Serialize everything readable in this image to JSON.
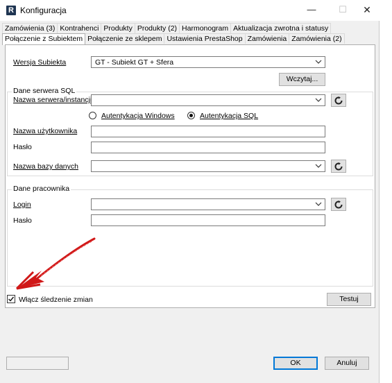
{
  "window": {
    "icon_letter": "R",
    "title": "Konfiguracja",
    "minimize": "—",
    "maximize": "☐",
    "close": "✕"
  },
  "tabs_row1": [
    "Zamówienia (3)",
    "Kontrahenci",
    "Produkty",
    "Produkty (2)",
    "Harmonogram",
    "Aktualizacja zwrotna i statusy"
  ],
  "tabs_row2": [
    "Połączenie z Subiektem",
    "Połączenie ze sklepem",
    "Ustawienia PrestaShop",
    "Zamówienia",
    "Zamówienia (2)"
  ],
  "active_tab": "Połączenie z Subiektem",
  "subiekt": {
    "version_label": "Wersja Subiekta",
    "version_value": "GT - Subiekt GT + Sfera",
    "load_button": "Wczytaj..."
  },
  "sql": {
    "group_title": "Dane serwera SQL",
    "server_label": "Nazwa serwera/instancji",
    "server_value": "",
    "auth_windows": "Autentykacja Windows",
    "auth_sql": "Autentykacja SQL",
    "auth_selected": "sql",
    "user_label": "Nazwa użytkownika",
    "user_value": "",
    "password_label": "Hasło",
    "password_value": "",
    "db_label": "Nazwa bazy danych",
    "db_value": ""
  },
  "employee": {
    "group_title": "Dane pracownika",
    "login_label": "Login",
    "login_value": "",
    "password_label": "Hasło",
    "password_value": ""
  },
  "tracking": {
    "checkbox_label": "Włącz śledzenie zmian",
    "checked": true,
    "test_button": "Testuj"
  },
  "footer": {
    "ok_button": "OK",
    "cancel_button": "Anuluj",
    "status_text": ""
  },
  "colors": {
    "annotation_arrow": "#d01818",
    "default_button_border": "#0078d7"
  },
  "icons": {
    "refresh": "refresh-icon",
    "dropdown": "chevron-down-icon",
    "annotation": "red-arrow-annotation"
  }
}
